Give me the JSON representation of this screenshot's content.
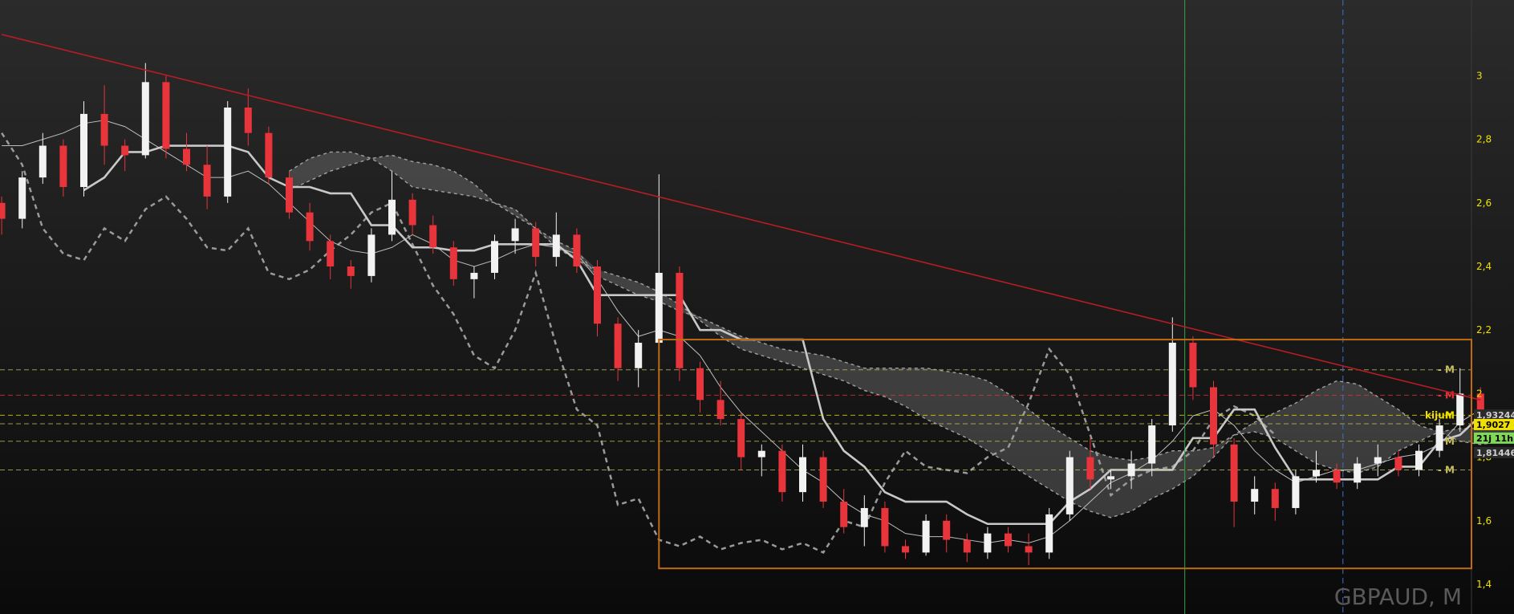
{
  "chart_data": {
    "type": "candlestick",
    "symbol": "GBPAUD, M",
    "ylim": [
      1.38,
      3.18
    ],
    "y_ticks": [
      "3",
      "2,8",
      "2,6",
      "2,4",
      "2,2",
      "2",
      "1,8",
      "1,6",
      "1,4"
    ],
    "y_tick_values": [
      3.0,
      2.8,
      2.6,
      2.4,
      2.2,
      2.0,
      1.8,
      1.6,
      1.4
    ],
    "colors": {
      "up": "#f2f2f2",
      "down": "#e8343b",
      "trendline": "#b81c24",
      "range_box": "#c06a12",
      "level": "#c8c060",
      "axis_text": "#f0e000"
    },
    "candles": [
      [
        2.6,
        2.62,
        2.5,
        2.55
      ],
      [
        2.55,
        2.7,
        2.52,
        2.68
      ],
      [
        2.68,
        2.82,
        2.66,
        2.78
      ],
      [
        2.78,
        2.8,
        2.62,
        2.65
      ],
      [
        2.65,
        2.92,
        2.62,
        2.88
      ],
      [
        2.88,
        2.97,
        2.72,
        2.78
      ],
      [
        2.78,
        2.8,
        2.7,
        2.75
      ],
      [
        2.75,
        3.04,
        2.74,
        2.98
      ],
      [
        2.98,
        3.0,
        2.74,
        2.77
      ],
      [
        2.77,
        2.82,
        2.7,
        2.72
      ],
      [
        2.72,
        2.78,
        2.58,
        2.62
      ],
      [
        2.62,
        2.92,
        2.6,
        2.9
      ],
      [
        2.9,
        2.96,
        2.78,
        2.82
      ],
      [
        2.82,
        2.84,
        2.66,
        2.68
      ],
      [
        2.68,
        2.7,
        2.55,
        2.57
      ],
      [
        2.57,
        2.6,
        2.45,
        2.48
      ],
      [
        2.48,
        2.5,
        2.36,
        2.4
      ],
      [
        2.4,
        2.42,
        2.33,
        2.37
      ],
      [
        2.37,
        2.52,
        2.35,
        2.5
      ],
      [
        2.5,
        2.7,
        2.48,
        2.61
      ],
      [
        2.61,
        2.63,
        2.5,
        2.53
      ],
      [
        2.53,
        2.56,
        2.44,
        2.46
      ],
      [
        2.46,
        2.48,
        2.34,
        2.36
      ],
      [
        2.36,
        2.4,
        2.3,
        2.38
      ],
      [
        2.38,
        2.5,
        2.36,
        2.48
      ],
      [
        2.48,
        2.55,
        2.44,
        2.52
      ],
      [
        2.52,
        2.54,
        2.4,
        2.43
      ],
      [
        2.43,
        2.57,
        2.4,
        2.5
      ],
      [
        2.5,
        2.52,
        2.38,
        2.4
      ],
      [
        2.4,
        2.42,
        2.18,
        2.22
      ],
      [
        2.22,
        2.24,
        2.04,
        2.08
      ],
      [
        2.08,
        2.2,
        2.02,
        2.16
      ],
      [
        2.16,
        2.69,
        2.12,
        2.38
      ],
      [
        2.38,
        2.4,
        2.04,
        2.08
      ],
      [
        2.08,
        2.1,
        1.94,
        1.98
      ],
      [
        1.98,
        2.04,
        1.9,
        1.92
      ],
      [
        1.92,
        1.94,
        1.76,
        1.8
      ],
      [
        1.8,
        1.84,
        1.74,
        1.82
      ],
      [
        1.82,
        1.84,
        1.66,
        1.69
      ],
      [
        1.69,
        1.84,
        1.66,
        1.8
      ],
      [
        1.8,
        1.82,
        1.64,
        1.66
      ],
      [
        1.66,
        1.7,
        1.56,
        1.58
      ],
      [
        1.58,
        1.68,
        1.52,
        1.64
      ],
      [
        1.64,
        1.66,
        1.5,
        1.52
      ],
      [
        1.52,
        1.54,
        1.48,
        1.5
      ],
      [
        1.5,
        1.62,
        1.49,
        1.6
      ],
      [
        1.6,
        1.62,
        1.5,
        1.54
      ],
      [
        1.54,
        1.56,
        1.47,
        1.5
      ],
      [
        1.5,
        1.58,
        1.48,
        1.56
      ],
      [
        1.56,
        1.58,
        1.5,
        1.52
      ],
      [
        1.52,
        1.56,
        1.46,
        1.5
      ],
      [
        1.5,
        1.64,
        1.48,
        1.62
      ],
      [
        1.62,
        1.82,
        1.6,
        1.8
      ],
      [
        1.8,
        1.86,
        1.7,
        1.73
      ],
      [
        1.73,
        1.76,
        1.7,
        1.74
      ],
      [
        1.74,
        1.82,
        1.7,
        1.78
      ],
      [
        1.78,
        1.92,
        1.74,
        1.9
      ],
      [
        1.9,
        2.24,
        1.88,
        2.16
      ],
      [
        2.16,
        2.18,
        1.98,
        2.02
      ],
      [
        2.02,
        2.04,
        1.8,
        1.84
      ],
      [
        1.84,
        1.86,
        1.58,
        1.66
      ],
      [
        1.66,
        1.74,
        1.62,
        1.7
      ],
      [
        1.7,
        1.72,
        1.6,
        1.64
      ],
      [
        1.64,
        1.76,
        1.62,
        1.74
      ],
      [
        1.74,
        1.82,
        1.72,
        1.76
      ],
      [
        1.76,
        1.78,
        1.7,
        1.72
      ],
      [
        1.72,
        1.8,
        1.7,
        1.78
      ],
      [
        1.78,
        1.84,
        1.74,
        1.8
      ],
      [
        1.8,
        1.82,
        1.74,
        1.76
      ],
      [
        1.76,
        1.84,
        1.74,
        1.82
      ],
      [
        1.82,
        1.92,
        1.8,
        1.9
      ],
      [
        1.9,
        2.08,
        1.88,
        2.0
      ],
      [
        2.0,
        2.02,
        1.9,
        1.92
      ]
    ],
    "trendline": [
      [
        3.13,
        0
      ],
      [
        1.98,
        72
      ]
    ],
    "range_box": {
      "top": 2.17,
      "bottom": 1.45,
      "start": 32
    },
    "levels": [
      {
        "value": 2.075,
        "label": "- M",
        "color": "#c8c060"
      },
      {
        "value": 1.995,
        "label": "- M",
        "color": "#e8343b"
      },
      {
        "value": 1.932,
        "label": "M",
        "color": "#f0e000"
      },
      {
        "value": 1.905,
        "label": "",
        "color": "#c8c060"
      },
      {
        "value": 1.85,
        "label": "- M",
        "color": "#c8c060"
      },
      {
        "value": 1.76,
        "label": "- M",
        "color": "#c8c060"
      }
    ],
    "level_text": "kijun",
    "price_labels": [
      {
        "value": 1.93244,
        "text": "1,93244",
        "bg": "#2a2a2a",
        "fg": "#cfcfcf"
      },
      {
        "value": 1.9027,
        "text": "1,9027",
        "bg": "#f0e000",
        "fg": "#000000"
      },
      {
        "value": 1.86,
        "text": "21j 11h",
        "bg": "#7ed957",
        "fg": "#000000"
      },
      {
        "value": 1.81446,
        "text": "1,81446",
        "bg": "#2a2a2a",
        "fg": "#cfcfcf"
      }
    ],
    "vlines": [
      {
        "at": 57.6,
        "color": "#3aa04a",
        "dash": false
      },
      {
        "at": 65.3,
        "color": "#3b6fd0",
        "dash": true
      },
      {
        "at": 74.2,
        "color": "#c02bd0",
        "dash": true
      },
      {
        "at": 80.2,
        "color": "#e0a020",
        "dash": true
      }
    ],
    "tenkan": [
      2.78,
      2.78,
      2.8,
      2.82,
      2.85,
      2.86,
      2.84,
      2.8,
      2.76,
      2.72,
      2.68,
      2.68,
      2.7,
      2.66,
      2.6,
      2.54,
      2.48,
      2.45,
      2.44,
      2.46,
      2.5,
      2.47,
      2.42,
      2.4,
      2.42,
      2.45,
      2.47,
      2.46,
      2.44,
      2.36,
      2.26,
      2.18,
      2.2,
      2.18,
      2.12,
      2.02,
      1.94,
      1.88,
      1.82,
      1.76,
      1.72,
      1.66,
      1.62,
      1.6,
      1.56,
      1.55,
      1.55,
      1.54,
      1.53,
      1.54,
      1.53,
      1.55,
      1.6,
      1.66,
      1.72,
      1.75,
      1.79,
      1.85,
      1.93,
      1.95,
      1.9,
      1.82,
      1.76,
      1.72,
      1.74,
      1.76,
      1.76,
      1.78,
      1.8,
      1.81,
      1.84,
      1.91,
      1.95
    ],
    "kijun": [
      null,
      null,
      null,
      null,
      2.64,
      2.68,
      2.76,
      2.76,
      2.78,
      2.78,
      2.78,
      2.78,
      2.76,
      2.68,
      2.65,
      2.65,
      2.63,
      2.63,
      2.53,
      2.53,
      2.46,
      2.46,
      2.45,
      2.45,
      2.47,
      2.47,
      2.47,
      2.47,
      2.42,
      2.31,
      2.31,
      2.31,
      2.31,
      2.31,
      2.2,
      2.2,
      2.17,
      2.17,
      2.17,
      2.17,
      1.92,
      1.82,
      1.77,
      1.69,
      1.66,
      1.66,
      1.66,
      1.62,
      1.59,
      1.59,
      1.59,
      1.59,
      1.66,
      1.7,
      1.76,
      1.76,
      1.76,
      1.76,
      1.86,
      1.86,
      1.95,
      1.95,
      1.83,
      1.73,
      1.73,
      1.73,
      1.73,
      1.73,
      1.77,
      1.77,
      1.85,
      1.87,
      1.93
    ],
    "span_a": [
      null,
      null,
      null,
      null,
      null,
      null,
      null,
      null,
      null,
      null,
      null,
      null,
      null,
      null,
      2.7,
      2.74,
      2.76,
      2.76,
      2.74,
      2.7,
      2.65,
      2.64,
      2.63,
      2.62,
      2.6,
      2.58,
      2.52,
      2.46,
      2.42,
      2.39,
      2.37,
      2.35,
      2.32,
      2.28,
      2.23,
      2.18,
      2.14,
      2.12,
      2.1,
      2.08,
      2.06,
      2.04,
      2.01,
      1.99,
      1.96,
      1.92,
      1.89,
      1.86,
      1.82,
      1.78,
      1.74,
      1.7,
      1.66,
      1.63,
      1.61,
      1.63,
      1.67,
      1.7,
      1.74,
      1.8,
      1.87,
      1.88,
      1.86,
      1.82,
      1.78,
      1.76,
      1.75,
      1.77,
      1.82,
      1.85,
      1.88,
      1.89,
      1.89,
      1.89,
      1.89,
      1.89,
      1.87,
      1.86,
      1.86,
      1.86,
      1.86,
      1.86,
      1.85,
      1.82
    ],
    "span_b": [
      null,
      null,
      null,
      null,
      null,
      null,
      null,
      null,
      null,
      null,
      null,
      null,
      null,
      null,
      2.64,
      2.67,
      2.7,
      2.72,
      2.74,
      2.75,
      2.73,
      2.72,
      2.7,
      2.66,
      2.6,
      2.56,
      2.52,
      2.48,
      2.45,
      2.37,
      2.34,
      2.31,
      2.29,
      2.26,
      2.24,
      2.21,
      2.18,
      2.16,
      2.14,
      2.13,
      2.12,
      2.1,
      2.08,
      2.08,
      2.08,
      2.08,
      2.07,
      2.06,
      2.04,
      2.0,
      1.95,
      1.9,
      1.86,
      1.82,
      1.8,
      1.79,
      1.8,
      1.82,
      1.82,
      1.83,
      1.87,
      1.91,
      1.94,
      1.97,
      2.01,
      2.04,
      2.03,
      1.99,
      1.95,
      1.9,
      1.88,
      1.85,
      1.84,
      1.85,
      1.85,
      1.84,
      1.82,
      1.8,
      1.78,
      1.76,
      1.76,
      1.77,
      1.79,
      1.8
    ],
    "chikou": [
      2.82,
      2.72,
      2.52,
      2.44,
      2.42,
      2.52,
      2.48,
      2.58,
      2.62,
      2.55,
      2.46,
      2.45,
      2.52,
      2.38,
      2.36,
      2.39,
      2.45,
      2.5,
      2.57,
      2.6,
      2.47,
      2.34,
      2.25,
      2.12,
      2.08,
      2.2,
      2.38,
      2.15,
      1.95,
      1.9,
      1.65,
      1.67,
      1.54,
      1.52,
      1.55,
      1.51,
      1.53,
      1.54,
      1.51,
      1.53,
      1.5,
      1.6,
      1.58,
      1.72,
      1.82,
      1.77,
      1.76,
      1.75,
      1.8,
      1.83,
      1.97,
      2.14,
      2.06,
      1.87,
      1.68,
      1.73,
      1.76,
      1.77,
      1.82,
      1.92,
      1.96,
      1.93,
      1.87
    ]
  }
}
